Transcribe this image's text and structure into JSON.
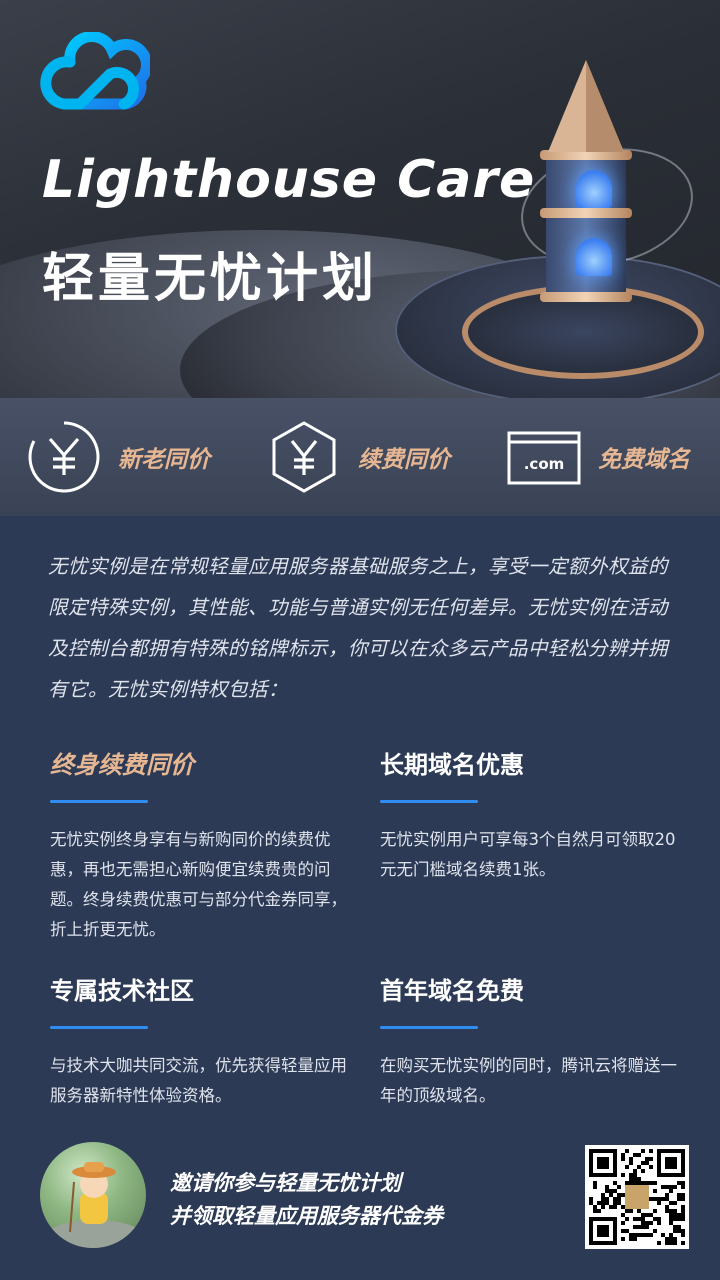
{
  "hero": {
    "title_en": "Lighthouse Care",
    "title_cn": "轻量无忧计划"
  },
  "features": [
    {
      "icon": "yen-circle-icon",
      "label": "新老同价"
    },
    {
      "icon": "yen-hexagon-icon",
      "label": "续费同价"
    },
    {
      "icon": "dotcom-window-icon",
      "label": "免费域名",
      "icon_text": ".com"
    }
  ],
  "intro": "无忧实例是在常规轻量应用服务器基础服务之上，享受一定额外权益的限定特殊实例，其性能、功能与普通实例无任何差异。无忧实例在活动及控制台都拥有特殊的铭牌标示，你可以在众多云产品中轻松分辨并拥有它。无忧实例特权包括：",
  "benefits": [
    {
      "title": "终身续费同价",
      "desc": "无忧实例终身享有与新购同价的续费优惠，再也无需担心新购便宜续费贵的问题。终身续费优惠可与部分代金券同享，折上折更无忧。"
    },
    {
      "title": "长期域名优惠",
      "desc": "无忧实例用户可享每3个自然月可领取20元无门槛域名续费1张。"
    },
    {
      "title": "专属技术社区",
      "desc": "与技术大咖共同交流，优先获得轻量应用服务器新特性体验资格。"
    },
    {
      "title": "首年域名免费",
      "desc": "在购买无忧实例的同时，腾讯云将赠送一年的顶级域名。"
    }
  ],
  "cta": {
    "line1": "邀请你参与轻量无忧计划",
    "line2": "并领取轻量应用服务器代金券"
  },
  "colors": {
    "accent_gold": "#e6b792",
    "accent_blue": "#2f8df1",
    "background": "#2c3a55"
  }
}
